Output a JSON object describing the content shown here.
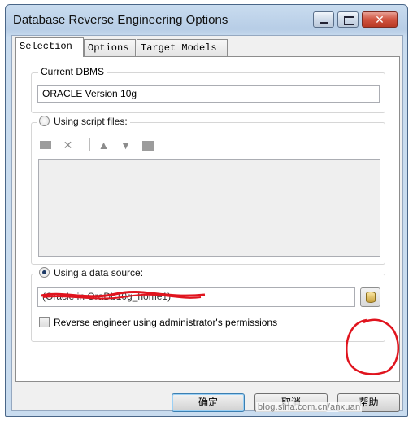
{
  "window": {
    "title": "Database Reverse Engineering Options",
    "close_glyph": "✕"
  },
  "tabs": [
    {
      "label": "Selection",
      "active": true
    },
    {
      "label": "Options",
      "active": false
    },
    {
      "label": "Target Models",
      "active": false
    }
  ],
  "current_dbms": {
    "legend": "Current DBMS",
    "value": "ORACLE Version 10g"
  },
  "script_files": {
    "label": "Using script files:",
    "selected": false,
    "toolbar_icons": [
      "add-file-icon",
      "delete-icon",
      "move-up-icon",
      "move-down-icon",
      "folder-icon"
    ]
  },
  "data_source": {
    "label": "Using a data source:",
    "selected": true,
    "value": "(Oracle in OraDb10g_home1)",
    "browse_icon": "database-icon"
  },
  "admin_permissions": {
    "label": "Reverse engineer using administrator's permissions",
    "checked": false
  },
  "footer": {
    "ok_label": "确定",
    "cancel_label": "取消",
    "help_label": "帮助"
  },
  "watermark": "blog.sina.com.cn/anxuan",
  "colors": {
    "annotation_red": "#e0141e",
    "title_bar": "#b7cde6",
    "close_button": "#c84b36"
  }
}
